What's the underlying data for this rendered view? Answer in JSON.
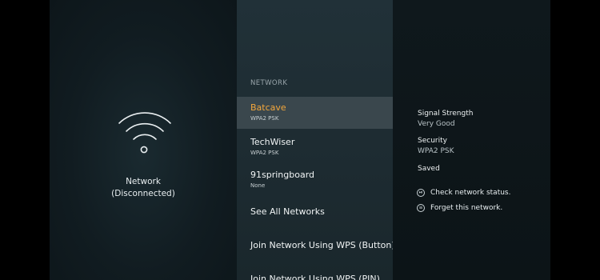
{
  "left": {
    "icon": "wifi-disconnected-icon",
    "status_line1": "Network",
    "status_line2": "(Disconnected)"
  },
  "menu": {
    "header": "NETWORK",
    "items": [
      {
        "name": "Batcave",
        "sub": "WPA2 PSK",
        "selected": true
      },
      {
        "name": "TechWiser",
        "sub": "WPA2 PSK"
      },
      {
        "name": "91springboard",
        "sub": "None"
      },
      {
        "name": "See All Networks"
      },
      {
        "name": "Join Network Using WPS (Button)"
      },
      {
        "name": "Join Network Using WPS (PIN)"
      }
    ]
  },
  "details": {
    "signal_label": "Signal Strength",
    "signal_value": "Very Good",
    "security_label": "Security",
    "security_value": "WPA2 PSK",
    "saved_label": "Saved",
    "actions": [
      {
        "icon": "play-pause-icon",
        "label": "Check network status."
      },
      {
        "icon": "menu-icon",
        "label": "Forget this network."
      }
    ]
  },
  "colors": {
    "selected_text": "#f3a73c",
    "selected_bg": "#3a474d",
    "menu_bg": "#213138"
  }
}
